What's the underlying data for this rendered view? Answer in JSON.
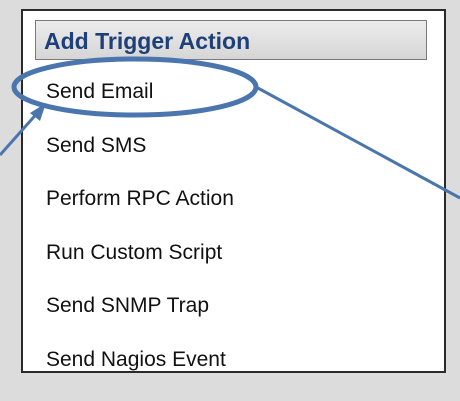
{
  "panel": {
    "title": "Add Trigger Action",
    "actions": [
      "Send Email",
      "Send SMS",
      "Perform RPC Action",
      "Run Custom Script",
      "Send SNMP Trap",
      "Send Nagios Event"
    ]
  },
  "annotation": {
    "highlighted_item": "Send Email",
    "color": "#4a76ad"
  }
}
